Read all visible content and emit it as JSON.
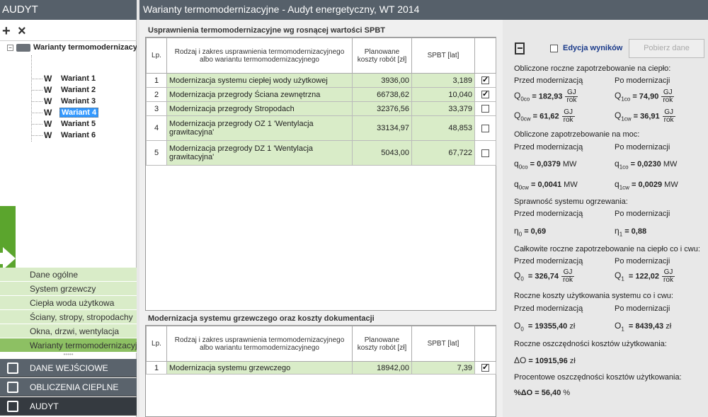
{
  "app": {
    "left_title": "AUDYT",
    "main_title": "Warianty termomodernizacyjne - Audyt energetyczny, WT 2014"
  },
  "toolbar": {
    "add_label": "+",
    "remove_label": "×"
  },
  "tree": {
    "root_label": "Warianty termomodernizacyjne",
    "items": [
      {
        "label": "Wariant 1",
        "selected": false
      },
      {
        "label": "Wariant 2",
        "selected": false
      },
      {
        "label": "Wariant 3",
        "selected": false
      },
      {
        "label": "Wariant 4",
        "selected": true
      },
      {
        "label": "Wariant 5",
        "selected": false
      },
      {
        "label": "Wariant 6",
        "selected": false
      }
    ],
    "icon_letter": "W",
    "scroll_arrow": "›"
  },
  "sections": [
    {
      "label": "Dane ogólne",
      "active": false
    },
    {
      "label": "System grzewczy",
      "active": false
    },
    {
      "label": "Ciepła woda użytkowa",
      "active": false
    },
    {
      "label": "Ściany, stropy, stropodachy",
      "active": false
    },
    {
      "label": "Okna, drzwi, wentylacja",
      "active": false
    },
    {
      "label": "Warianty termomodernizacyjne",
      "active": true
    }
  ],
  "grip": "•••••",
  "modules": [
    {
      "label": "DANE WEJŚCIOWE",
      "active": false
    },
    {
      "label": "OBLICZENIA CIEPLNE",
      "active": false
    },
    {
      "label": "AUDYT",
      "active": true
    }
  ],
  "table1": {
    "title": "Usprawnienia termomodernizacyjne wg rosnącej wartości SPBT",
    "headers": {
      "lp": "Lp.",
      "name": "Rodzaj i zakres usprawnienia termomodernizacyjnego albo wariantu termomodernizacyjnego",
      "cost": "Planowane koszty robót [zł]",
      "spbt": "SPBT [lat]"
    },
    "rows": [
      {
        "lp": "1",
        "name": "Modernizacja systemu ciepłej wody użytkowej",
        "cost": "3936,00",
        "spbt": "3,189",
        "checked": true
      },
      {
        "lp": "2",
        "name": "Modernizacja przegrody Ściana zewnętrzna",
        "cost": "66738,62",
        "spbt": "10,040",
        "checked": true
      },
      {
        "lp": "3",
        "name": "Modernizacja przegrody Stropodach",
        "cost": "32376,56",
        "spbt": "33,379",
        "checked": false
      },
      {
        "lp": "4",
        "name": "Modernizacja przegrody OZ 1 'Wentylacja grawitacyjna'",
        "cost": "33134,97",
        "spbt": "48,853",
        "checked": false
      },
      {
        "lp": "5",
        "name": "Modernizacja przegrody DZ 1 'Wentylacja grawitacyjna'",
        "cost": "5043,00",
        "spbt": "67,722",
        "checked": false
      }
    ]
  },
  "table2": {
    "title": "Modernizacja systemu grzewczego oraz koszty dokumentacji",
    "headers": {
      "lp": "Lp.",
      "name": "Rodzaj i zakres usprawnienia termomodernizacyjnego albo wariantu termomodernizacyjnego",
      "cost": "Planowane koszty robót [zł]",
      "spbt": "SPBT [lat]"
    },
    "rows": [
      {
        "lp": "1",
        "name": "Modernizacja systemu grzewczego",
        "cost": "18942,00",
        "spbt": "7,39",
        "checked": true
      }
    ]
  },
  "results": {
    "edit_label": "Edycja wyników",
    "fetch_label": "Pobierz dane",
    "before": "Przed modernizacją",
    "after": "Po modernizacji",
    "gj": "GJ",
    "rok": "rok",
    "mw": "MW",
    "zl": "zł",
    "heat_title": "Obliczone roczne zapotrzebowanie na ciepło:",
    "q0co": "= 182,93",
    "q1co": "= 74,90",
    "q0cw": "= 61,62",
    "q1cw": "= 36,91",
    "power_title": "Obliczone zapotrzebowanie na moc:",
    "p0co": "= 0,0379",
    "p1co": "= 0,0230",
    "p0cw": "= 0,0041",
    "p1cw": "= 0,0029",
    "eff_title": "Sprawność systemu ogrzewania:",
    "eta0": "= 0,69",
    "eta1": "= 0,88",
    "total_title": "Całkowite roczne zapotrzebowanie na ciepło co i cwu:",
    "q0": "= 326,74",
    "q1": "= 122,02",
    "cost_title": "Roczne koszty użytkowania systemu co i cwu:",
    "o0": "= 19355,40",
    "o1": "= 8439,43",
    "save_title": "Roczne oszczędności kosztów użytkowania:",
    "do": "= 10915,96",
    "pct_title": "Procentowe oszczędności kosztów użytkowania:",
    "pct": "%ΔO = 56,40",
    "pct_unit": "%"
  }
}
